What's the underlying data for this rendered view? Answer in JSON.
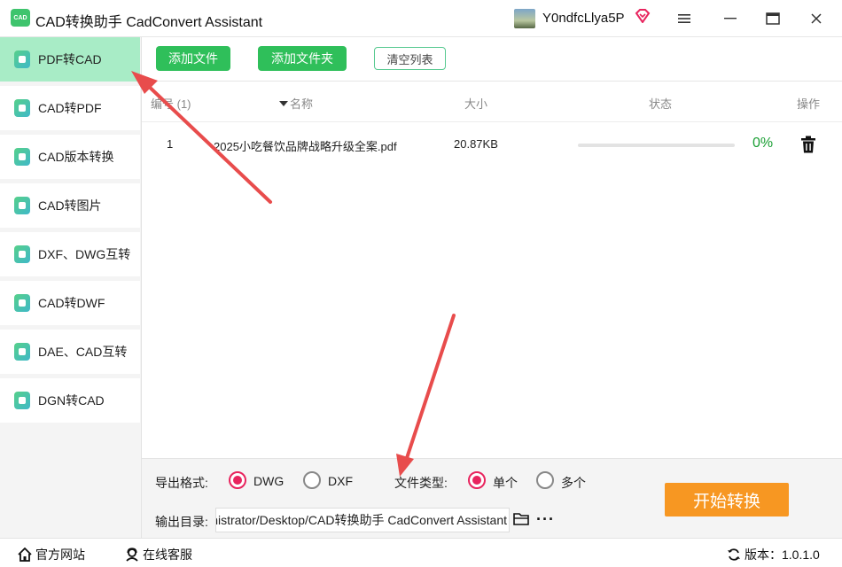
{
  "app": {
    "logo_text": "CAD",
    "title": "CAD转换助手 CadConvert Assistant",
    "username": "Y0ndfcLlya5P"
  },
  "sidebar": {
    "items": [
      {
        "label": "PDF转CAD",
        "active": true
      },
      {
        "label": "CAD转PDF",
        "active": false
      },
      {
        "label": "CAD版本转换",
        "active": false
      },
      {
        "label": "CAD转图片",
        "active": false
      },
      {
        "label": "DXF、DWG互转",
        "active": false
      },
      {
        "label": "CAD转DWF",
        "active": false
      },
      {
        "label": "DAE、CAD互转",
        "active": false
      },
      {
        "label": "DGN转CAD",
        "active": false
      }
    ]
  },
  "toolbar": {
    "add_file": "添加文件",
    "add_folder": "添加文件夹",
    "clear_list": "清空列表"
  },
  "table": {
    "headers": {
      "index": "编号 (1)",
      "name": "名称",
      "size": "大小",
      "status": "状态",
      "action": "操作"
    },
    "rows": [
      {
        "index": "1",
        "name": "2025小吃餐饮品牌战略升级全案.pdf",
        "size": "20.87KB",
        "progress": 0,
        "percent": "0%"
      }
    ]
  },
  "options": {
    "format_label": "导出格式:",
    "format_dwg": "DWG",
    "format_dxf": "DXF",
    "format_selected": "DWG",
    "filetype_label": "文件类型:",
    "filetype_single": "单个",
    "filetype_multi": "多个",
    "filetype_selected": "单个",
    "outdir_label": "输出目录:",
    "outdir_value": "C:/Users/Administrator/Desktop/CAD转换助手 CadConvert Assistant",
    "start_button": "开始转换"
  },
  "footer": {
    "website": "官方网站",
    "support": "在线客服",
    "version": "版本：1.0.1.0"
  },
  "colors": {
    "accent_green": "#2fbf5a",
    "active_sidebar": "#a8ecc6",
    "start_orange": "#f79722",
    "radio_on": "#e8245e",
    "annotation_arrow": "#e84c4c"
  }
}
